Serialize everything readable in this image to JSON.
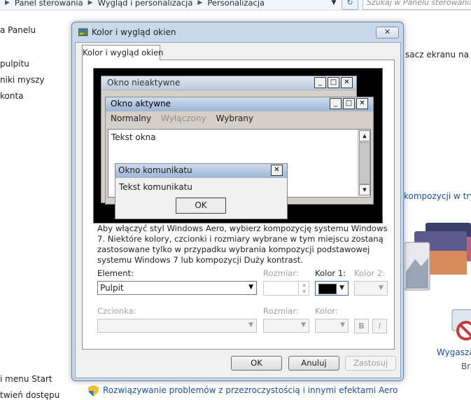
{
  "background": {
    "breadcrumb": [
      "Panel sterowania",
      "Wygląd i personalizacja",
      "Personalizacja"
    ],
    "search_placeholder": "Szukaj w Panelu sterowania",
    "sidebar_items": [
      {
        "label": "a Panelu"
      },
      {
        "label": "pulpitu"
      },
      {
        "label": "niki myszy"
      },
      {
        "label": "konta"
      },
      {
        "label": "i menu Start"
      },
      {
        "label": "twień dostępu"
      }
    ],
    "right_text_1": "sacz ekranu na ko",
    "right_text_2": "kompozycji w trybie",
    "screensaver_label": "Wygaszac",
    "screensaver_sub": "Bra",
    "bottom_link": "Rozwiązywanie problemów z przezroczystością i innymi efektami Aero"
  },
  "dialog": {
    "title": "Kolor i wygląd okien",
    "close_label": "✕",
    "tab_label": "Kolor i wygląd okien",
    "preview": {
      "inactive_title": "Okno nieaktywne",
      "active_title": "Okno aktywne",
      "menu_items": [
        "Normalny",
        "Wyłączony",
        "Wybrany"
      ],
      "window_text": "Tekst okna",
      "message_title": "Okno komunikatu",
      "message_text": "Tekst komunikatu",
      "message_ok": "OK"
    },
    "description": "Aby włączyć styl Windows Aero, wybierz kompozycję systemu Windows 7. Niektóre kolory, czcionki i rozmiary wybrane w tym miejscu zostaną zastosowane tylko w przypadku wybrania kompozycji podstawowej systemu Windows 7 lub kompozycji Duży kontrast.",
    "element_label": "Element:",
    "element_value": "Pulpit",
    "size_label": "Rozmiar:",
    "color1_label": "Kolor 1:",
    "color2_label": "Kolor 2:",
    "color1_value": "#000000",
    "font_label": "Czcionka:",
    "size2_label": "Rozmiar:",
    "color_label": "Kolor:",
    "bold_label": "B",
    "italic_label": "I",
    "ok_label": "OK",
    "cancel_label": "Anuluj",
    "apply_label": "Zastosuj"
  }
}
